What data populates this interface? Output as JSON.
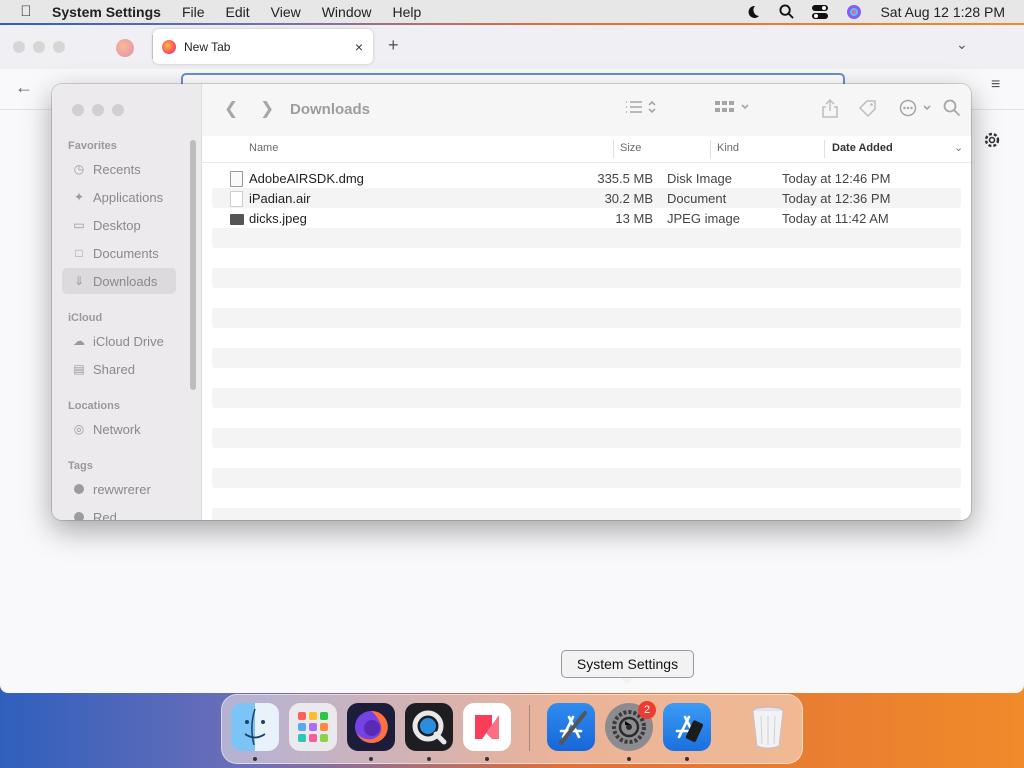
{
  "menubar": {
    "apple": "",
    "app_name": "System Settings",
    "menus": [
      "File",
      "Edit",
      "View",
      "Window",
      "Help"
    ],
    "clock": "Sat Aug 12  1:28 PM"
  },
  "browser": {
    "tab_title": "New Tab",
    "tab_close": "×",
    "new_tab": "+",
    "back": "←",
    "list_all_tabs": "⌄",
    "menu": "≡"
  },
  "finder": {
    "title": "Downloads",
    "sidebar": {
      "sections": [
        {
          "label": "Favorites",
          "items": [
            "Recents",
            "Applications",
            "Desktop",
            "Documents",
            "Downloads"
          ]
        },
        {
          "label": "iCloud",
          "items": [
            "iCloud Drive",
            "Shared"
          ]
        },
        {
          "label": "Locations",
          "items": [
            "Network"
          ]
        },
        {
          "label": "Tags",
          "items": [
            "rewwrerer",
            "Red"
          ]
        }
      ],
      "selected": "Downloads"
    },
    "columns": [
      "Name",
      "Size",
      "Kind",
      "Date Added"
    ],
    "sort_column": "Date Added",
    "files": [
      {
        "name": "AdobeAIRSDK.dmg",
        "size": "335.5 MB",
        "kind": "Disk Image",
        "date": "Today at 12:46 PM",
        "icon": "disk-image-icon"
      },
      {
        "name": "iPadian.air",
        "size": "30.2 MB",
        "kind": "Document",
        "date": "Today at 12:36 PM",
        "icon": "document-icon"
      },
      {
        "name": "dicks.jpeg",
        "size": "13 MB",
        "kind": "JPEG image",
        "date": "Today at 11:42 AM",
        "icon": "image-icon"
      }
    ]
  },
  "dock": {
    "tooltip": "System Settings",
    "apps": [
      "Finder",
      "Launchpad",
      "Firefox",
      "QuickTime Player",
      "News",
      "Xcode",
      "System Settings",
      "Simulator",
      "Trash"
    ],
    "badge": "2"
  }
}
